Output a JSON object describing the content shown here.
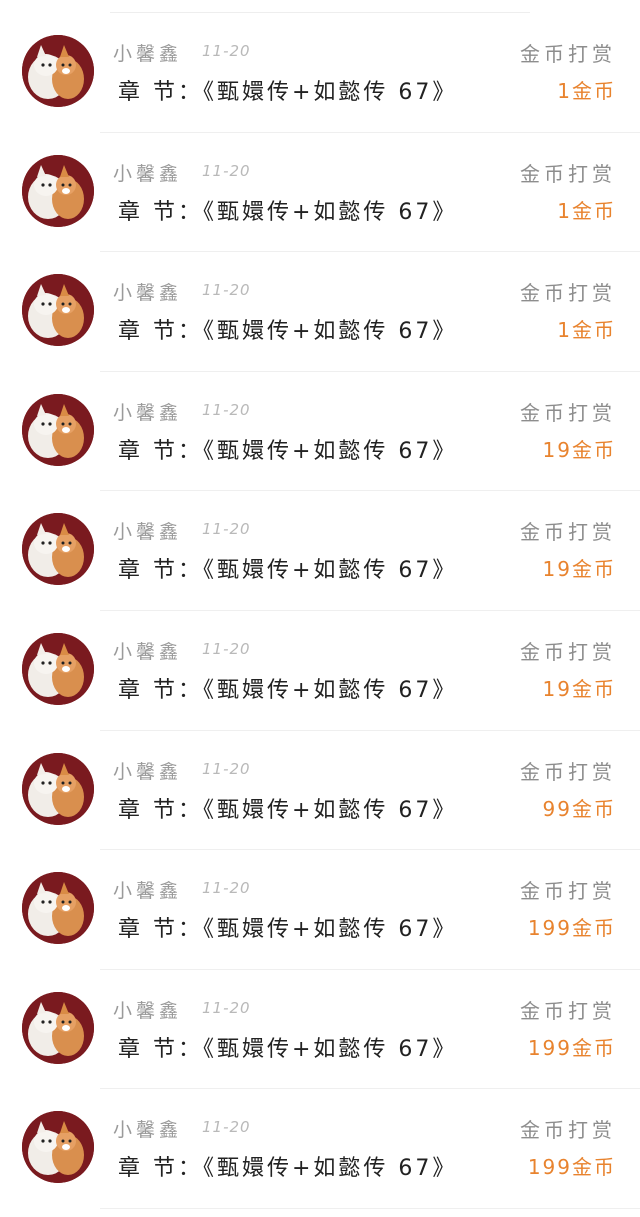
{
  "accent_color": "#e8832e",
  "records": [
    {
      "user": "小馨鑫",
      "date": "11-20",
      "chapter": "章 节：《甄嬛传+如懿传 67》",
      "label": "金币打赏",
      "amount": "1金币"
    },
    {
      "user": "小馨鑫",
      "date": "11-20",
      "chapter": "章 节：《甄嬛传+如懿传 67》",
      "label": "金币打赏",
      "amount": "1金币"
    },
    {
      "user": "小馨鑫",
      "date": "11-20",
      "chapter": "章 节：《甄嬛传+如懿传 67》",
      "label": "金币打赏",
      "amount": "1金币"
    },
    {
      "user": "小馨鑫",
      "date": "11-20",
      "chapter": "章 节：《甄嬛传+如懿传 67》",
      "label": "金币打赏",
      "amount": "19金币"
    },
    {
      "user": "小馨鑫",
      "date": "11-20",
      "chapter": "章 节：《甄嬛传+如懿传 67》",
      "label": "金币打赏",
      "amount": "19金币"
    },
    {
      "user": "小馨鑫",
      "date": "11-20",
      "chapter": "章 节：《甄嬛传+如懿传 67》",
      "label": "金币打赏",
      "amount": "19金币"
    },
    {
      "user": "小馨鑫",
      "date": "11-20",
      "chapter": "章 节：《甄嬛传+如懿传 67》",
      "label": "金币打赏",
      "amount": "99金币"
    },
    {
      "user": "小馨鑫",
      "date": "11-20",
      "chapter": "章 节：《甄嬛传+如懿传 67》",
      "label": "金币打赏",
      "amount": "199金币"
    },
    {
      "user": "小馨鑫",
      "date": "11-20",
      "chapter": "章 节：《甄嬛传+如懿传 67》",
      "label": "金币打赏",
      "amount": "199金币"
    },
    {
      "user": "小馨鑫",
      "date": "11-20",
      "chapter": "章 节：《甄嬛传+如懿传 67》",
      "label": "金币打赏",
      "amount": "199金币"
    }
  ]
}
